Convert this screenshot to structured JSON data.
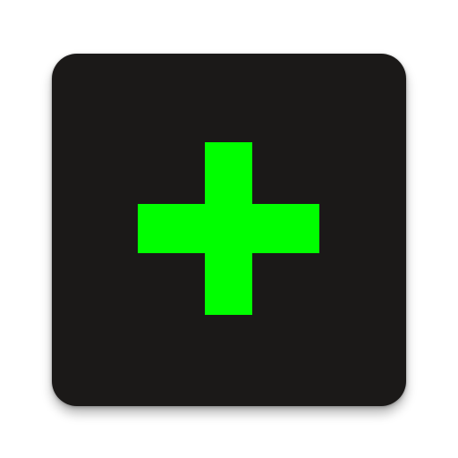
{
  "icon": {
    "name": "add-icon",
    "glyph": "plus",
    "background_color": "#1b1918",
    "glyph_color": "#00ff00"
  },
  "page": {
    "background_color": "#ffffff"
  }
}
